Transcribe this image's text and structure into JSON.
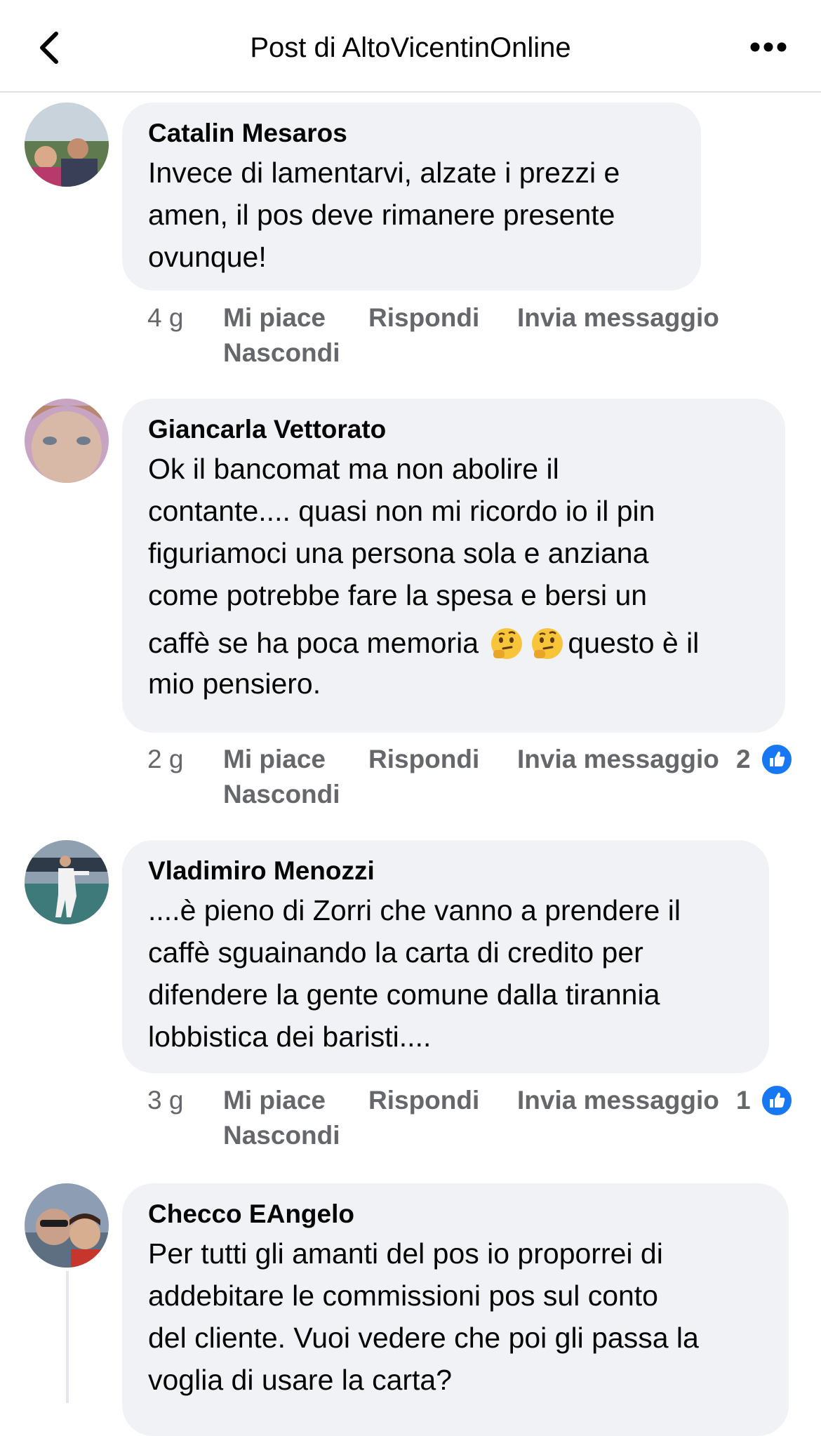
{
  "header": {
    "title": "Post di AltoVicentinOnline",
    "back_icon": "chevron-left-icon",
    "more_icon": "more-dots-icon"
  },
  "actions": {
    "like": "Mi piace",
    "reply": "Rispondi",
    "message": "Invia messaggio",
    "hide": "Nascondi"
  },
  "colors": {
    "bubble": "#f0f2f5",
    "meta_text": "#65676b",
    "like_blue": "#1877f2"
  },
  "comments": [
    {
      "author": "Catalin Mesaros",
      "lines": [
        "Invece di lamentarvi, alzate i prezzi e",
        "amen, il pos deve rimanere presente",
        "ovunque!"
      ],
      "time": "4 g",
      "likes": ""
    },
    {
      "author": "Giancarla Vettorato",
      "lines": [
        "Ok il bancomat ma non abolire il",
        "contante.... quasi non mi ricordo io il pin",
        "figuriamoci una persona sola e anziana",
        "come potrebbe fare la spesa e bersi un"
      ],
      "line5_a": "caffè se ha poca memoria ",
      "line5_b": "questo è il",
      "line6": "mio pensiero.",
      "emoji": "thinking-face",
      "time": "2 g",
      "likes": "2"
    },
    {
      "author": "Vladimiro Menozzi",
      "lines": [
        "....è pieno di Zorri che vanno a prendere il",
        "caffè sguainando la carta di credito per",
        "difendere la gente comune dalla tirannia",
        "lobbistica dei baristi...."
      ],
      "time": "3 g",
      "likes": "1"
    },
    {
      "author": "Checco EAngelo",
      "lines": [
        "Per tutti gli amanti del pos io proporrei di",
        "addebitare le commissioni pos sul conto",
        "del cliente. Vuoi vedere che poi gli passa la",
        "voglia di usare la carta?"
      ]
    }
  ]
}
